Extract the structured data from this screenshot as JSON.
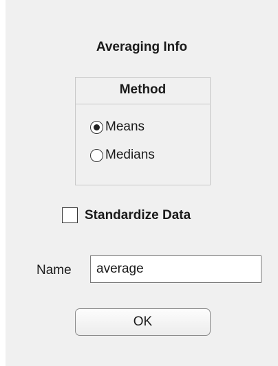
{
  "dialog": {
    "title": "Averaging Info",
    "method": {
      "header": "Method",
      "options": [
        {
          "label": "Means",
          "selected": true
        },
        {
          "label": "Medians",
          "selected": false
        }
      ]
    },
    "standardize": {
      "label": "Standardize Data",
      "checked": false
    },
    "name": {
      "label": "Name",
      "value": "average"
    },
    "ok_label": "OK"
  }
}
